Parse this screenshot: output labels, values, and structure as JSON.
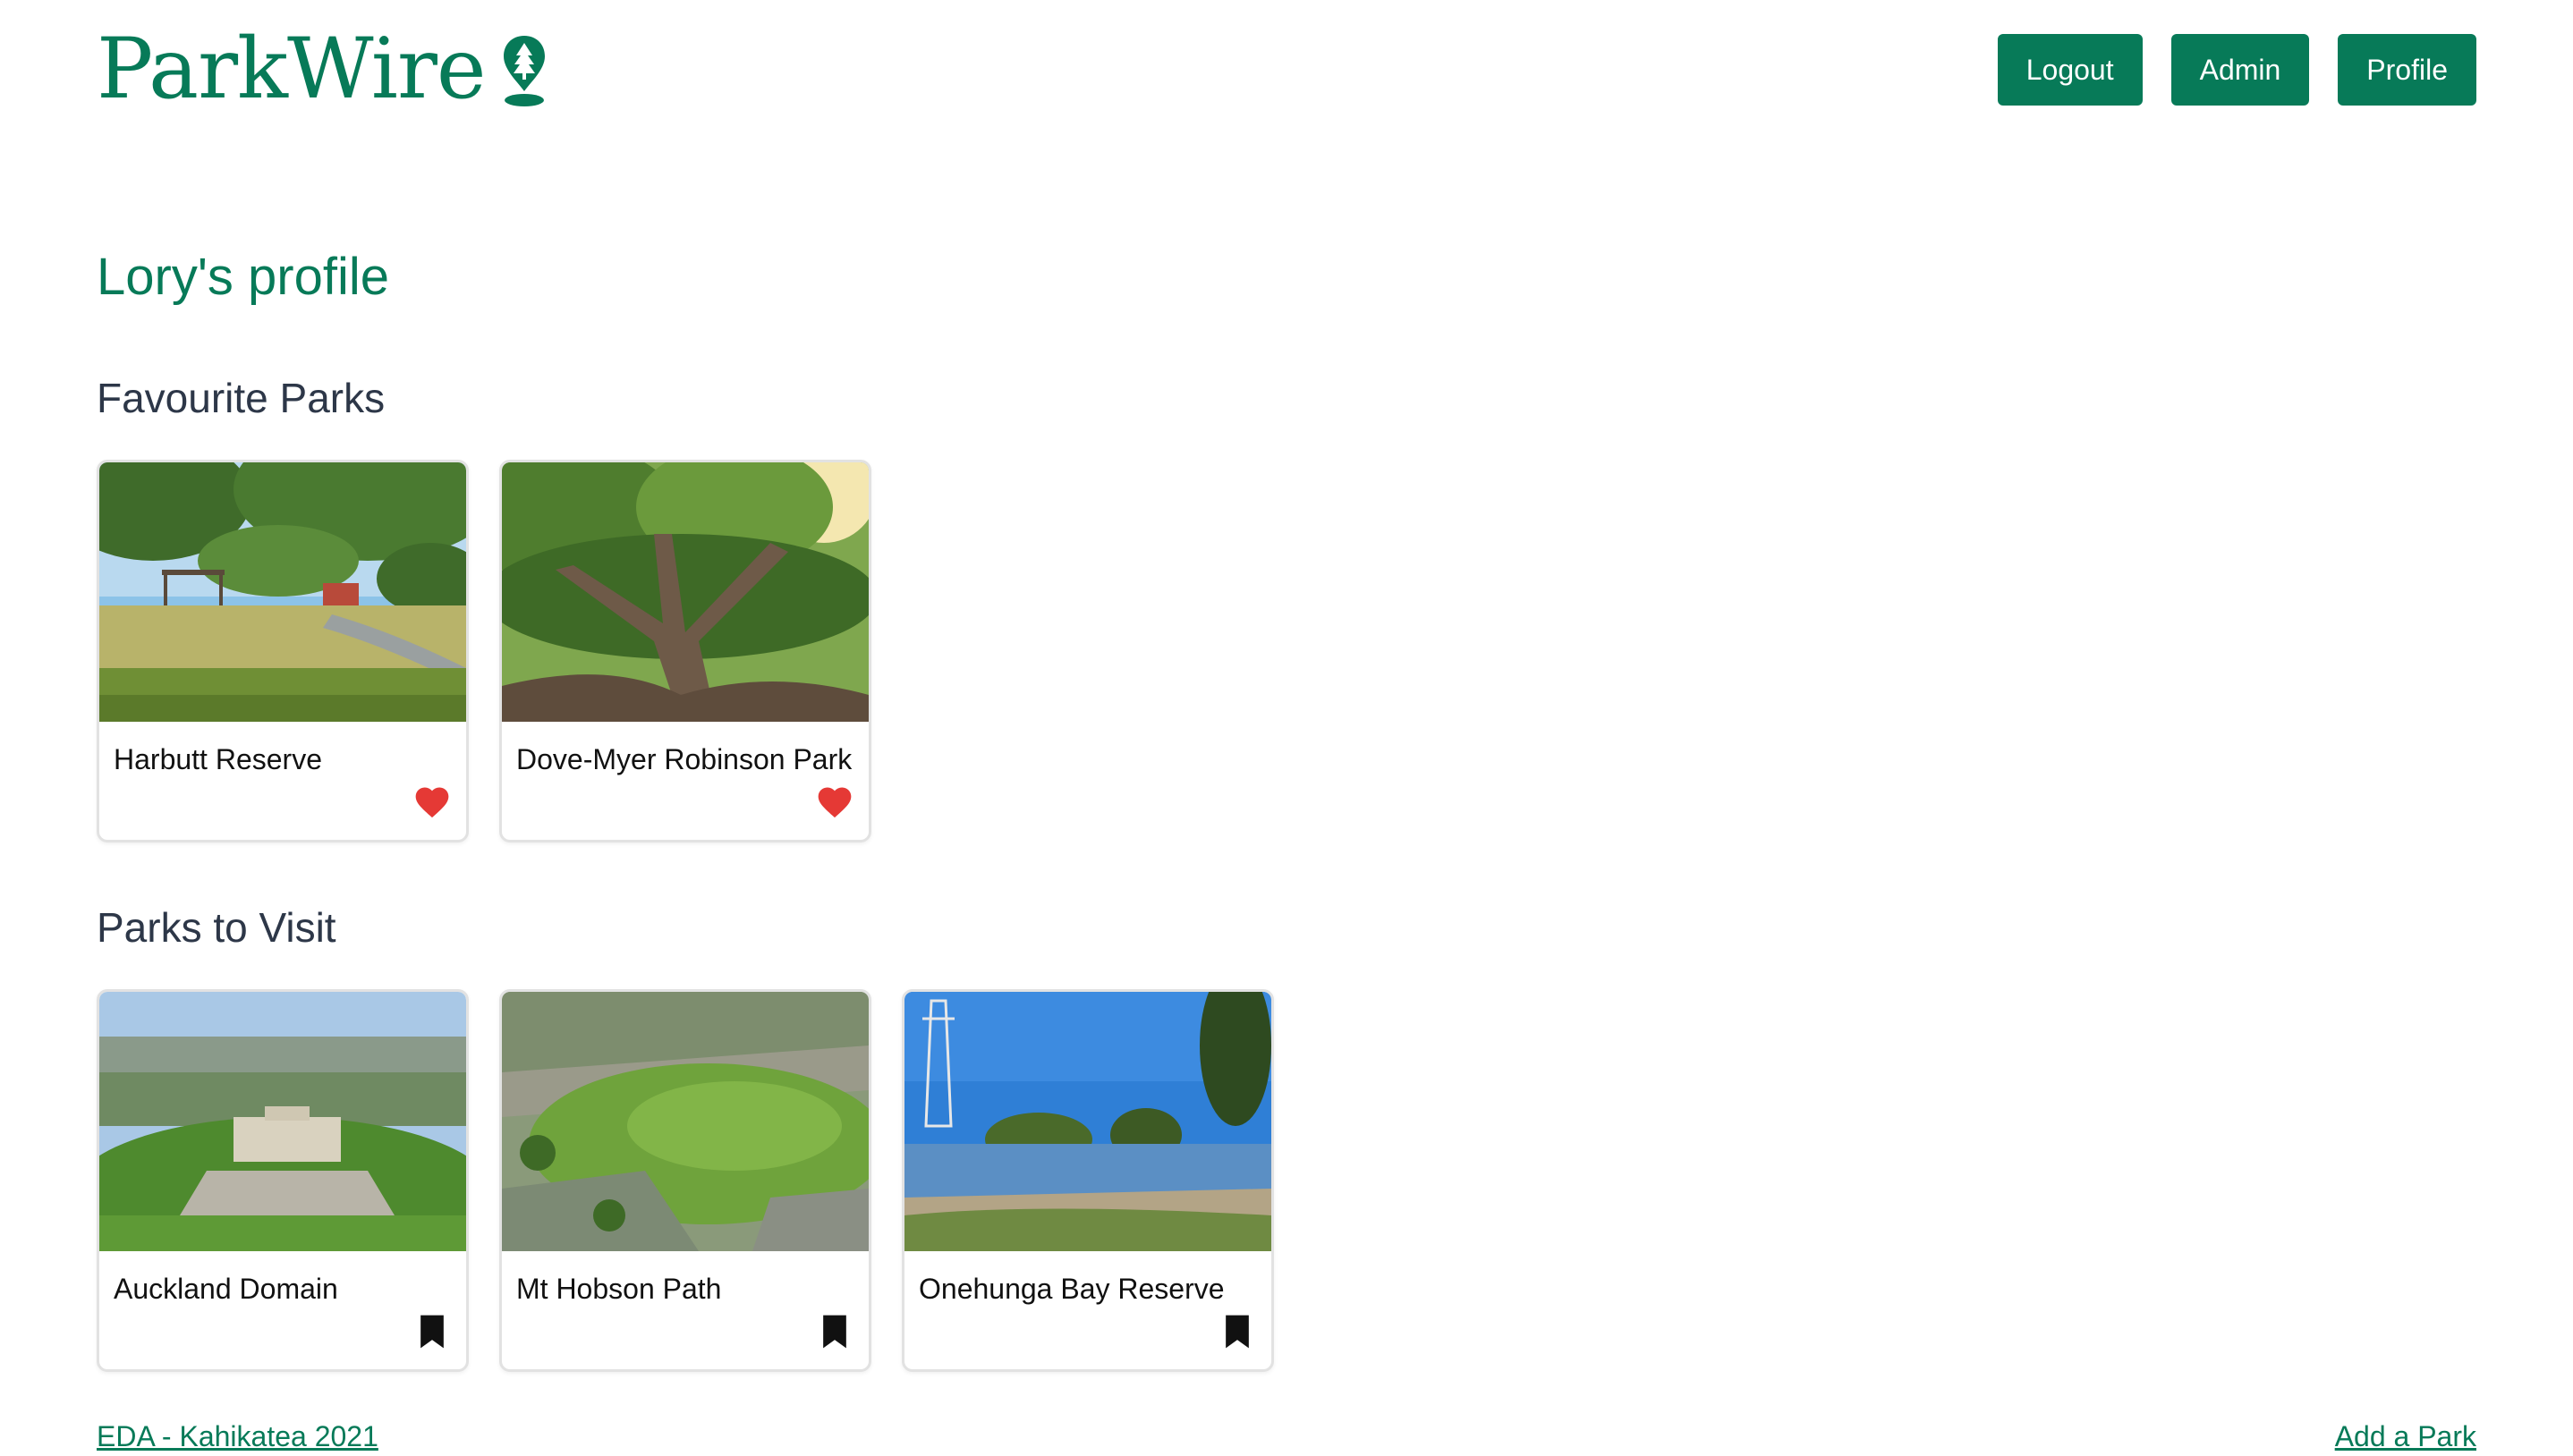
{
  "header": {
    "logo_text": "ParkWire",
    "nav": {
      "logout": "Logout",
      "admin": "Admin",
      "profile": "Profile"
    }
  },
  "main": {
    "profile_title": "Lory's profile",
    "favourites": {
      "heading": "Favourite Parks",
      "parks": [
        {
          "name": "Harbutt Reserve",
          "icon": "heart-icon"
        },
        {
          "name": "Dove-Myer Robinson Park",
          "icon": "heart-icon"
        }
      ]
    },
    "to_visit": {
      "heading": "Parks to Visit",
      "parks": [
        {
          "name": "Auckland Domain",
          "icon": "bookmark-icon"
        },
        {
          "name": "Mt Hobson Path",
          "icon": "bookmark-icon"
        },
        {
          "name": "Onehunga Bay Reserve",
          "icon": "bookmark-icon"
        }
      ]
    }
  },
  "footer": {
    "credit_link": "EDA - Kahikatea 2021",
    "add_park_link": "Add a Park"
  },
  "colors": {
    "brand": "#077a58",
    "heart": "#e53935",
    "text": "#2d3748"
  }
}
